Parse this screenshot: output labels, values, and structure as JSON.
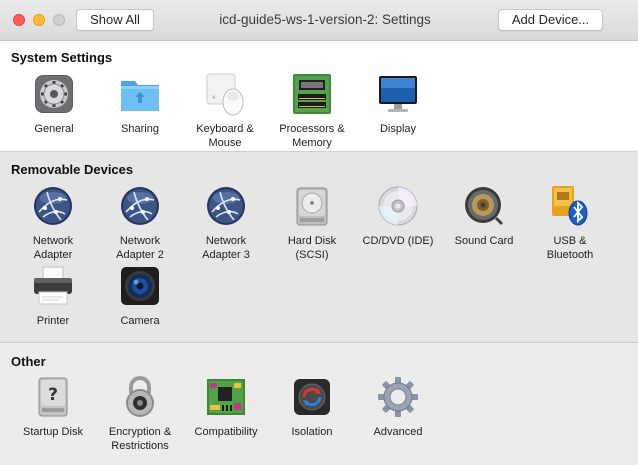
{
  "window": {
    "title": "icd-guide5-ws-1-version-2: Settings",
    "show_all_label": "Show All",
    "add_device_label": "Add Device..."
  },
  "sections": {
    "system": {
      "title": "System Settings",
      "items": [
        {
          "label": "General",
          "icon": "general-icon"
        },
        {
          "label": "Sharing",
          "icon": "sharing-folder-icon"
        },
        {
          "label": "Keyboard &\nMouse",
          "icon": "keyboard-mouse-icon"
        },
        {
          "label": "Processors &\nMemory",
          "icon": "processor-memory-icon"
        },
        {
          "label": "Display",
          "icon": "display-icon"
        }
      ]
    },
    "removable": {
      "title": "Removable Devices",
      "items": [
        {
          "label": "Network\nAdapter",
          "icon": "network-globe-icon"
        },
        {
          "label": "Network\nAdapter 2",
          "icon": "network-globe-icon"
        },
        {
          "label": "Network\nAdapter 3",
          "icon": "network-globe-icon"
        },
        {
          "label": "Hard Disk\n(SCSI)",
          "icon": "hard-disk-icon"
        },
        {
          "label": "CD/DVD (IDE)",
          "icon": "cd-dvd-icon"
        },
        {
          "label": "Sound Card",
          "icon": "speaker-icon"
        },
        {
          "label": "USB &\nBluetooth",
          "icon": "usb-bluetooth-icon"
        },
        {
          "label": "Printer",
          "icon": "printer-icon"
        },
        {
          "label": "Camera",
          "icon": "camera-icon"
        }
      ]
    },
    "other": {
      "title": "Other",
      "items": [
        {
          "label": "Startup Disk",
          "icon": "startup-disk-icon"
        },
        {
          "label": "Encryption &\nRestrictions",
          "icon": "padlock-icon"
        },
        {
          "label": "Compatibility",
          "icon": "compatibility-board-icon"
        },
        {
          "label": "Isolation",
          "icon": "isolation-icon"
        },
        {
          "label": "Advanced",
          "icon": "gear-icon"
        }
      ]
    }
  },
  "colors": {
    "close": "#fd5f57",
    "minimize": "#febc2e",
    "zoom_disabled": "#cfcfcf",
    "system_bg": "#ffffff",
    "removable_bg": "#e6e6e6",
    "other_bg": "#ececec"
  }
}
